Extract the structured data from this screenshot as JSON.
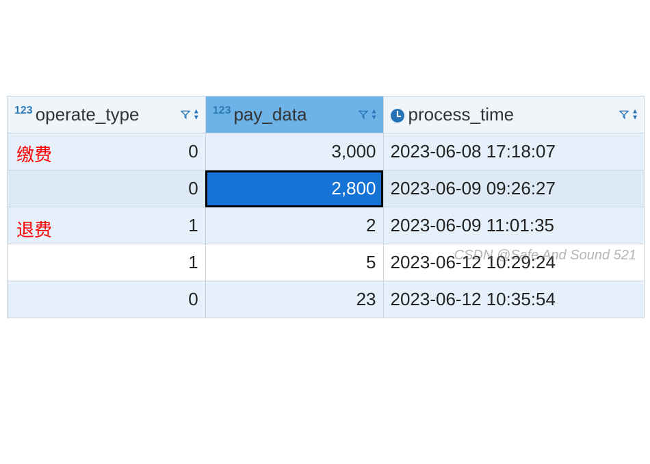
{
  "columns": {
    "operate_type": {
      "label": "operate_type",
      "type_prefix": "123"
    },
    "pay_data": {
      "label": "pay_data",
      "type_prefix": "123"
    },
    "process_time": {
      "label": "process_time",
      "type_prefix": "clock"
    }
  },
  "rows": [
    {
      "operate_type": "0",
      "pay_data": "3,000",
      "process_time": "2023-06-08 17:18:07"
    },
    {
      "operate_type": "0",
      "pay_data": "2,800",
      "process_time": "2023-06-09 09:26:27"
    },
    {
      "operate_type": "1",
      "pay_data": "2",
      "process_time": "2023-06-09 11:01:35"
    },
    {
      "operate_type": "1",
      "pay_data": "5",
      "process_time": "2023-06-12 10:29:24"
    },
    {
      "operate_type": "0",
      "pay_data": "23",
      "process_time": "2023-06-12 10:35:54"
    }
  ],
  "annotations": {
    "row0": "缴费",
    "row2": "退费"
  },
  "watermark": "CSDN @Safe And Sound 521"
}
